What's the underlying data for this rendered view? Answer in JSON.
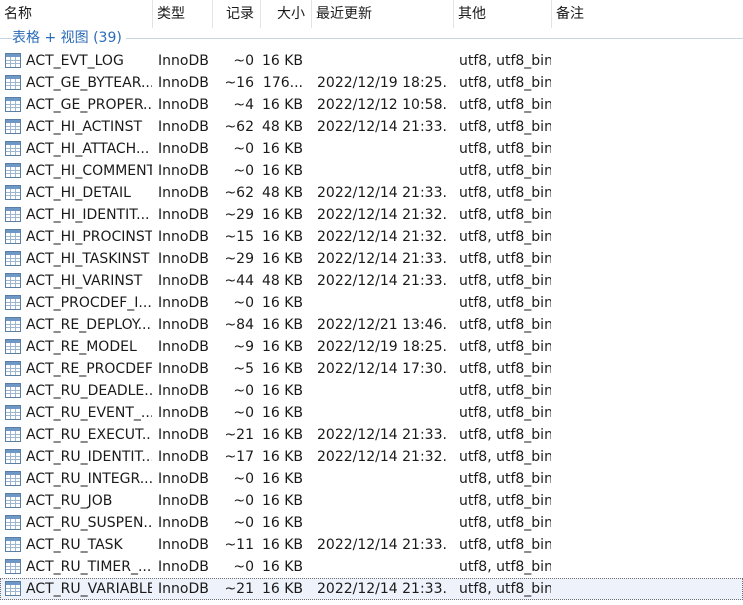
{
  "columns": {
    "name": "名称",
    "engine": "类型",
    "rows": "记录",
    "size": "大小",
    "updated": "最近更新",
    "other": "其他",
    "comment": "备注"
  },
  "group": {
    "label": "表格 + 视图 (39)"
  },
  "icon_name": "table-icon",
  "accent": "#2b6cb8",
  "tables": [
    {
      "name": "ACT_EVT_LOG",
      "engine": "InnoDB",
      "rows": "~0",
      "size": "16 KB",
      "updated": "",
      "other": "utf8, utf8_bin"
    },
    {
      "name": "ACT_GE_BYTEAR...",
      "engine": "InnoDB",
      "rows": "~16",
      "size": "176...",
      "updated": "2022/12/19 18:25...",
      "other": "utf8, utf8_bin"
    },
    {
      "name": "ACT_GE_PROPER...",
      "engine": "InnoDB",
      "rows": "~4",
      "size": "16 KB",
      "updated": "2022/12/12 10:58...",
      "other": "utf8, utf8_bin"
    },
    {
      "name": "ACT_HI_ACTINST",
      "engine": "InnoDB",
      "rows": "~62",
      "size": "48 KB",
      "updated": "2022/12/14 21:33...",
      "other": "utf8, utf8_bin"
    },
    {
      "name": "ACT_HI_ATTACH...",
      "engine": "InnoDB",
      "rows": "~0",
      "size": "16 KB",
      "updated": "",
      "other": "utf8, utf8_bin"
    },
    {
      "name": "ACT_HI_COMMENT",
      "engine": "InnoDB",
      "rows": "~0",
      "size": "16 KB",
      "updated": "",
      "other": "utf8, utf8_bin"
    },
    {
      "name": "ACT_HI_DETAIL",
      "engine": "InnoDB",
      "rows": "~62",
      "size": "48 KB",
      "updated": "2022/12/14 21:33...",
      "other": "utf8, utf8_bin"
    },
    {
      "name": "ACT_HI_IDENTIT...",
      "engine": "InnoDB",
      "rows": "~29",
      "size": "16 KB",
      "updated": "2022/12/14 21:32...",
      "other": "utf8, utf8_bin"
    },
    {
      "name": "ACT_HI_PROCINST",
      "engine": "InnoDB",
      "rows": "~15",
      "size": "16 KB",
      "updated": "2022/12/14 21:32...",
      "other": "utf8, utf8_bin"
    },
    {
      "name": "ACT_HI_TASKINST",
      "engine": "InnoDB",
      "rows": "~29",
      "size": "16 KB",
      "updated": "2022/12/14 21:33...",
      "other": "utf8, utf8_bin"
    },
    {
      "name": "ACT_HI_VARINST",
      "engine": "InnoDB",
      "rows": "~44",
      "size": "48 KB",
      "updated": "2022/12/14 21:33...",
      "other": "utf8, utf8_bin"
    },
    {
      "name": "ACT_PROCDEF_I...",
      "engine": "InnoDB",
      "rows": "~0",
      "size": "16 KB",
      "updated": "",
      "other": "utf8, utf8_bin"
    },
    {
      "name": "ACT_RE_DEPLOY...",
      "engine": "InnoDB",
      "rows": "~84",
      "size": "16 KB",
      "updated": "2022/12/21 13:46...",
      "other": "utf8, utf8_bin"
    },
    {
      "name": "ACT_RE_MODEL",
      "engine": "InnoDB",
      "rows": "~9",
      "size": "16 KB",
      "updated": "2022/12/19 18:25...",
      "other": "utf8, utf8_bin"
    },
    {
      "name": "ACT_RE_PROCDEF",
      "engine": "InnoDB",
      "rows": "~5",
      "size": "16 KB",
      "updated": "2022/12/14 17:30...",
      "other": "utf8, utf8_bin"
    },
    {
      "name": "ACT_RU_DEADLE...",
      "engine": "InnoDB",
      "rows": "~0",
      "size": "16 KB",
      "updated": "",
      "other": "utf8, utf8_bin"
    },
    {
      "name": "ACT_RU_EVENT_...",
      "engine": "InnoDB",
      "rows": "~0",
      "size": "16 KB",
      "updated": "",
      "other": "utf8, utf8_bin"
    },
    {
      "name": "ACT_RU_EXECUT...",
      "engine": "InnoDB",
      "rows": "~21",
      "size": "16 KB",
      "updated": "2022/12/14 21:33...",
      "other": "utf8, utf8_bin"
    },
    {
      "name": "ACT_RU_IDENTIT...",
      "engine": "InnoDB",
      "rows": "~17",
      "size": "16 KB",
      "updated": "2022/12/14 21:32...",
      "other": "utf8, utf8_bin"
    },
    {
      "name": "ACT_RU_INTEGR...",
      "engine": "InnoDB",
      "rows": "~0",
      "size": "16 KB",
      "updated": "",
      "other": "utf8, utf8_bin"
    },
    {
      "name": "ACT_RU_JOB",
      "engine": "InnoDB",
      "rows": "~0",
      "size": "16 KB",
      "updated": "",
      "other": "utf8, utf8_bin"
    },
    {
      "name": "ACT_RU_SUSPEN...",
      "engine": "InnoDB",
      "rows": "~0",
      "size": "16 KB",
      "updated": "",
      "other": "utf8, utf8_bin"
    },
    {
      "name": "ACT_RU_TASK",
      "engine": "InnoDB",
      "rows": "~11",
      "size": "16 KB",
      "updated": "2022/12/14 21:33...",
      "other": "utf8, utf8_bin"
    },
    {
      "name": "ACT_RU_TIMER_...",
      "engine": "InnoDB",
      "rows": "~0",
      "size": "16 KB",
      "updated": "",
      "other": "utf8, utf8_bin"
    },
    {
      "name": "ACT_RU_VARIABLE",
      "engine": "InnoDB",
      "rows": "~21",
      "size": "16 KB",
      "updated": "2022/12/14 21:33...",
      "other": "utf8, utf8_bin",
      "selected": true
    }
  ]
}
